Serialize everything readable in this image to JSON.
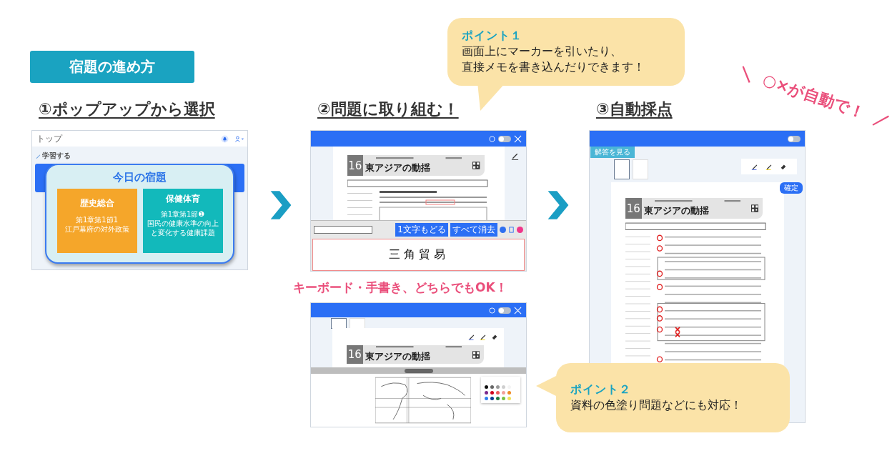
{
  "badge": "宿題の進め方",
  "steps": [
    {
      "title": "①ポップアップから選択"
    },
    {
      "title": "②問題に取り組む！"
    },
    {
      "title": "③自動採点"
    }
  ],
  "callouts": [
    {
      "label": "ポイント１",
      "lines": [
        "画面上にマーカーを引いたり、",
        "直接メモを書き込んだりできます！"
      ]
    },
    {
      "label": "ポイント２",
      "lines": [
        "資料の色塗り問題などにも対応！"
      ]
    }
  ],
  "tagline": "キーボード・手書き、どちらでもOK！",
  "auto_note": {
    "left": "＼",
    "text": "○×が自動で！",
    "right": "／"
  },
  "screen1": {
    "title": "トップ",
    "section": "学習する",
    "popup": {
      "title": "今日の宿題",
      "cards": [
        {
          "subject": "歴史総合",
          "lines": [
            "第1章第1節1",
            "江戸幕府の対外政策"
          ],
          "color": "#f5a62a"
        },
        {
          "subject": "保健体育",
          "lines": [
            "第1章第1節❶",
            "国民の健康水準の向上",
            "と変化する健康課題"
          ],
          "color": "#12b9bb"
        }
      ]
    }
  },
  "screen2": {
    "keyboard_on": false,
    "worksheet": {
      "number": "16",
      "title": "東アジアの動揺"
    },
    "buttons": [
      "1文字もどる",
      "すべて消去"
    ],
    "handwriting": "三角貿易"
  },
  "screen2b": {
    "keyboard_on": false,
    "worksheet": {
      "number": "16",
      "title": "東アジアの動揺"
    },
    "palette": [
      {
        "color": "#111111"
      },
      {
        "color": "#666666"
      },
      {
        "color": "#9a9a9a"
      },
      {
        "color": "#cfcfcf"
      },
      {
        "color": "#f4f4f4"
      },
      {
        "color": "#7b2a8c"
      },
      {
        "color": "#d0021b"
      },
      {
        "color": "#ee5a5a"
      },
      {
        "color": "#f3a19a"
      },
      {
        "color": "#f08a24"
      },
      {
        "color": "#2f80ed"
      },
      {
        "color": "#0b3d91"
      },
      {
        "color": "#1e7a3c"
      },
      {
        "color": "#7ac143"
      },
      {
        "color": "#f2e35c"
      }
    ]
  },
  "screen3": {
    "keyboard_on": false,
    "answer_button": "解答を見る",
    "confirm_button": "確定",
    "worksheet": {
      "number": "16",
      "title": "東アジアの動揺"
    }
  }
}
